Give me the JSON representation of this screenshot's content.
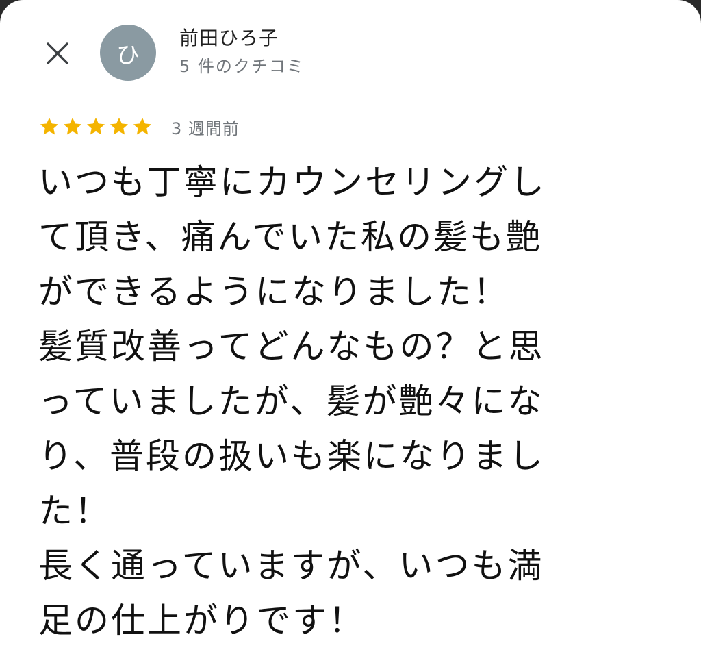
{
  "colors": {
    "avatar_bg": "#8a9aa2",
    "star": "#f4b400",
    "secondary_text": "#70757a"
  },
  "header": {
    "close_icon": "close-icon",
    "avatar_initial": "ひ",
    "reviewer_name": "前田ひろ子",
    "review_count": "5 件のクチコミ"
  },
  "review": {
    "rating": 5,
    "rating_max": 5,
    "star_icon": "star-icon",
    "date": "3 週間前",
    "lines": [
      "いつも丁寧にカウンセリングし",
      "て頂き、痛んでいた私の髪も艶",
      "ができるようになりました！",
      "髪質改善ってどんなもの？と思",
      "っていましたが、髪が艶々にな",
      "り、普段の扱いも楽になりまし",
      "た！",
      "長く通っていますが、いつも満",
      "足の仕上がりです！"
    ]
  }
}
